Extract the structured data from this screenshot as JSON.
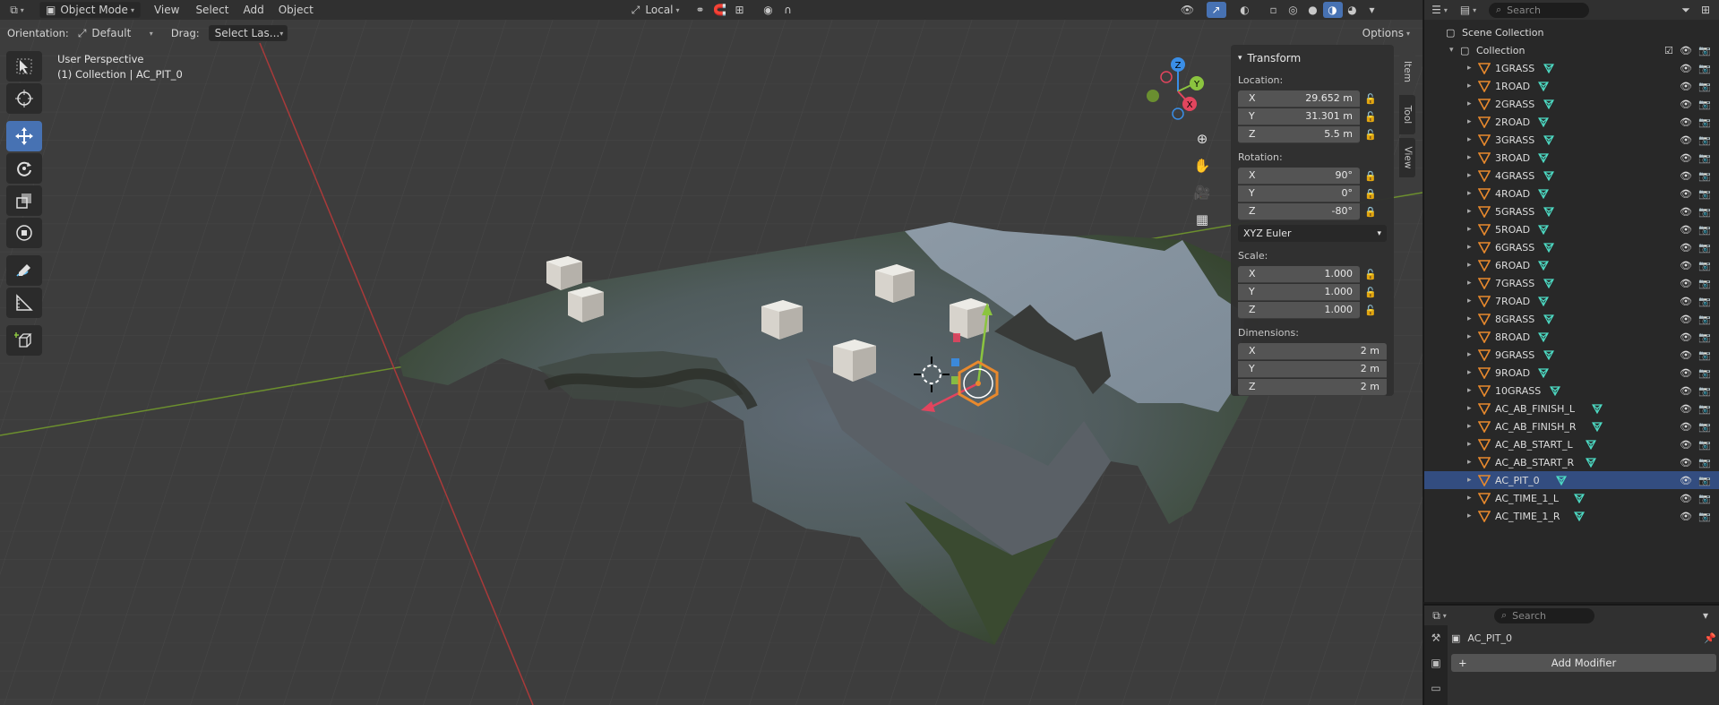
{
  "viewport_header": {
    "mode": "Object Mode",
    "menu": [
      "View",
      "Select",
      "Add",
      "Object"
    ],
    "pivot": "Local"
  },
  "tool_header": {
    "orientation_label": "Orientation:",
    "orientation_value": "Default",
    "drag_label": "Drag:",
    "drag_value": "Select Las...",
    "options": "Options"
  },
  "viewport_info": {
    "view": "User Perspective",
    "context": "(1) Collection | AC_PIT_0"
  },
  "gizmo": {
    "x": "X",
    "y": "Y",
    "z": "Z"
  },
  "transform_panel": {
    "title": "Transform",
    "location_label": "Location:",
    "location": [
      {
        "axis": "X",
        "value": "29.652 m"
      },
      {
        "axis": "Y",
        "value": "31.301 m"
      },
      {
        "axis": "Z",
        "value": "5.5 m"
      }
    ],
    "rotation_label": "Rotation:",
    "rotation": [
      {
        "axis": "X",
        "value": "90°"
      },
      {
        "axis": "Y",
        "value": "0°"
      },
      {
        "axis": "Z",
        "value": "-80°"
      }
    ],
    "rotation_mode": "XYZ Euler",
    "scale_label": "Scale:",
    "scale": [
      {
        "axis": "X",
        "value": "1.000"
      },
      {
        "axis": "Y",
        "value": "1.000"
      },
      {
        "axis": "Z",
        "value": "1.000"
      }
    ],
    "dimensions_label": "Dimensions:",
    "dimensions": [
      {
        "axis": "X",
        "value": "2 m"
      },
      {
        "axis": "Y",
        "value": "2 m"
      },
      {
        "axis": "Z",
        "value": "2 m"
      }
    ]
  },
  "sidebar_tabs": [
    "Item",
    "Tool",
    "View"
  ],
  "outliner": {
    "search_placeholder": "Search",
    "scene_collection": "Scene Collection",
    "collection": "Collection",
    "items": [
      {
        "name": "1GRASS"
      },
      {
        "name": "1ROAD"
      },
      {
        "name": "2GRASS"
      },
      {
        "name": "2ROAD"
      },
      {
        "name": "3GRASS"
      },
      {
        "name": "3ROAD"
      },
      {
        "name": "4GRASS"
      },
      {
        "name": "4ROAD"
      },
      {
        "name": "5GRASS"
      },
      {
        "name": "5ROAD"
      },
      {
        "name": "6GRASS"
      },
      {
        "name": "6ROAD"
      },
      {
        "name": "7GRASS"
      },
      {
        "name": "7ROAD"
      },
      {
        "name": "8GRASS"
      },
      {
        "name": "8ROAD"
      },
      {
        "name": "9GRASS"
      },
      {
        "name": "9ROAD"
      },
      {
        "name": "10GRASS"
      },
      {
        "name": "AC_AB_FINISH_L"
      },
      {
        "name": "AC_AB_FINISH_R"
      },
      {
        "name": "AC_AB_START_L"
      },
      {
        "name": "AC_AB_START_R"
      },
      {
        "name": "AC_PIT_0",
        "selected": true
      },
      {
        "name": "AC_TIME_1_L"
      },
      {
        "name": "AC_TIME_1_R"
      }
    ]
  },
  "properties": {
    "search_placeholder": "Search",
    "object_name": "AC_PIT_0",
    "add_modifier": "Add Modifier"
  },
  "colors": {
    "accent": "#4772b3",
    "selected_row": "#334d80",
    "axis_x": "#e2455e",
    "axis_y": "#8bc43f",
    "axis_z": "#3a8ee6",
    "object_orange": "#e8892d",
    "mesh_icon": "#4ddbc4"
  }
}
